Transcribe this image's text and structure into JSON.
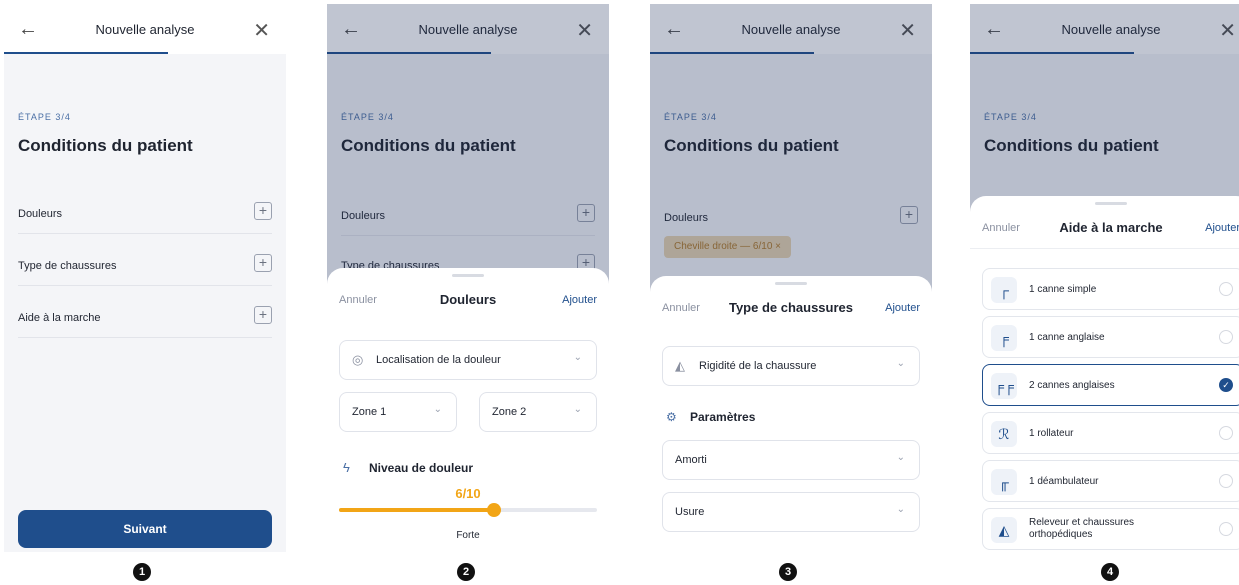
{
  "header": {
    "title": "Nouvelle analyse",
    "back_icon": "arrow-left-icon",
    "close_icon": "close-icon"
  },
  "step": {
    "label": "ÉTAPE 3/4",
    "title": "Conditions du patient"
  },
  "conditions": [
    {
      "label": "Douleurs"
    },
    {
      "label": "Type de chaussures"
    },
    {
      "label": "Aide à la marche"
    }
  ],
  "next_button": "Suivant",
  "sheet_actions": {
    "cancel": "Annuler",
    "add": "Ajouter"
  },
  "pain_sheet": {
    "title": "Douleurs",
    "location_placeholder": "Localisation de la douleur",
    "zone1": "Zone 1",
    "zone2": "Zone 2",
    "level_title": "Niveau de douleur",
    "level_value": "6/10",
    "level_fraction": 0.6,
    "level_label": "Forte"
  },
  "shoe_sheet": {
    "title": "Type de chaussures",
    "chip": "Cheville droite — 6/10 ×",
    "rigidity": "Rigidité de la chaussure",
    "params_title": "Paramètres",
    "damping": "Amorti",
    "wear": "Usure"
  },
  "aid_sheet": {
    "title": "Aide à la marche",
    "options": [
      {
        "label": "1 canne simple",
        "selected": false
      },
      {
        "label": "1 canne anglaise",
        "selected": false
      },
      {
        "label": "2 cannes anglaises",
        "selected": true
      },
      {
        "label": "1 rollateur",
        "selected": false
      },
      {
        "label": "1 déambulateur",
        "selected": false
      },
      {
        "label": "Releveur et chaussures orthopédiques",
        "selected": false
      }
    ]
  },
  "badges": [
    "1",
    "2",
    "3",
    "4"
  ],
  "colors": {
    "primary": "#1f4e8c",
    "accent": "#f2a516",
    "chip_bg": "#e7d3b0"
  }
}
